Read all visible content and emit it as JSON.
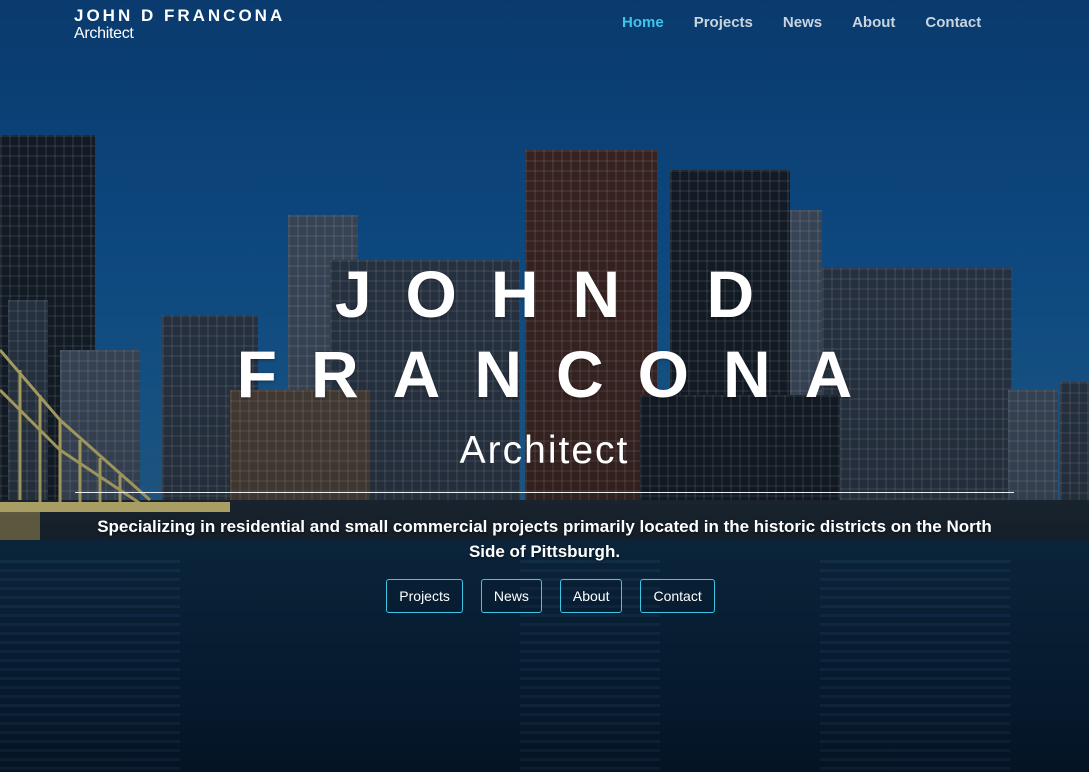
{
  "header": {
    "brand_name": "JOHN D FRANCONA",
    "brand_sub": "Architect",
    "nav": [
      {
        "label": "Home",
        "active": true
      },
      {
        "label": "Projects",
        "active": false
      },
      {
        "label": "News",
        "active": false
      },
      {
        "label": "About",
        "active": false
      },
      {
        "label": "Contact",
        "active": false
      }
    ]
  },
  "hero": {
    "title_line1": "JOHN D",
    "title_line2": "FRANCONA",
    "subtitle": "Architect",
    "tagline": "Specializing in residential and small commercial projects primarily located in the historic districts on the North Side of Pittsburgh.",
    "buttons": [
      "Projects",
      "News",
      "About",
      "Contact"
    ]
  },
  "colors": {
    "accent": "#3fc5e8",
    "nav_text": "#c9d4de",
    "sky": "#0e4f8c"
  }
}
